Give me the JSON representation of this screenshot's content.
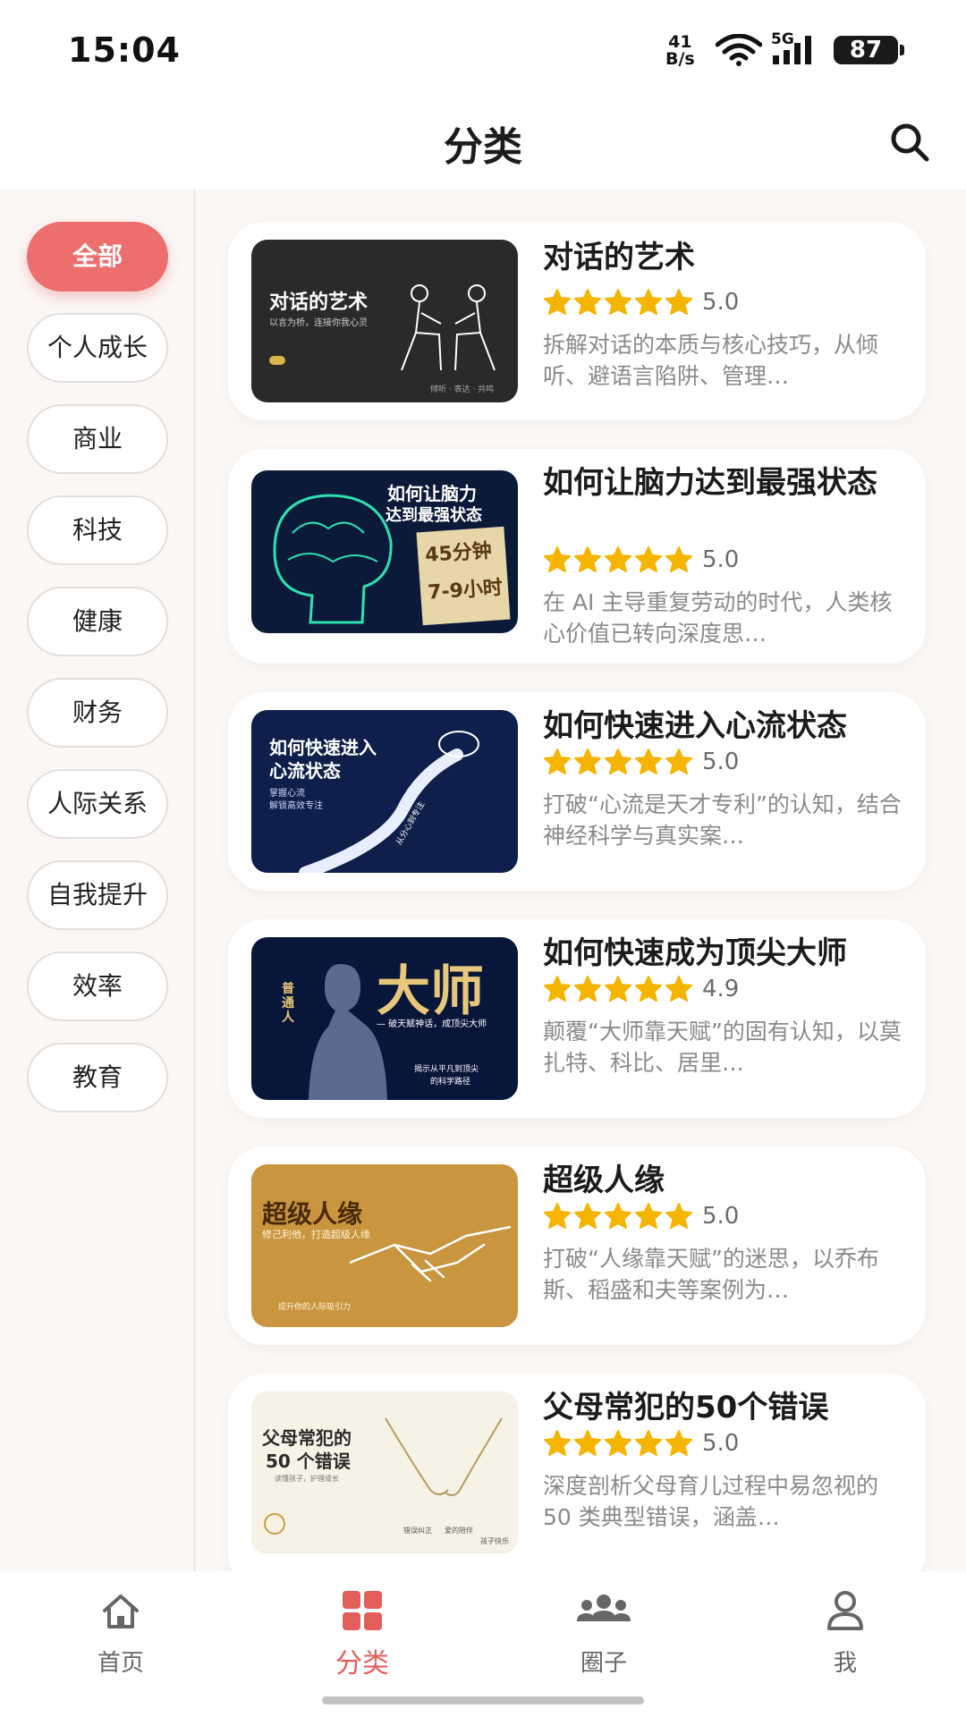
{
  "status_bar": {
    "time": "15:04",
    "speed_value": "41",
    "speed_unit": "B/s",
    "network": "5G",
    "battery": "87"
  },
  "header": {
    "title": "分类",
    "search_icon": "search-icon"
  },
  "sidebar": {
    "categories": [
      {
        "label": "全部",
        "active": true
      },
      {
        "label": "个人成长",
        "active": false
      },
      {
        "label": "商业",
        "active": false
      },
      {
        "label": "科技",
        "active": false
      },
      {
        "label": "健康",
        "active": false
      },
      {
        "label": "财务",
        "active": false
      },
      {
        "label": "人际关系",
        "active": false
      },
      {
        "label": "自我提升",
        "active": false
      },
      {
        "label": "效率",
        "active": false
      },
      {
        "label": "教育",
        "active": false
      }
    ]
  },
  "books": [
    {
      "title": "对话的艺术",
      "rating": 5.0,
      "rating_text": "5.0",
      "description": "拆解对话的本质与核心技巧，从倾听、避语言陷阱、管理…",
      "cover": {
        "line1": "对话的艺术",
        "line2": "以言为桥，连接你我心灵",
        "footer": "倾听 · 表达 · 共鸣"
      }
    },
    {
      "title": "如何让脑力达到最强状态",
      "rating": 5.0,
      "rating_text": "5.0",
      "description": "在 AI 主导重复劳动的时代，人类核心价值已转向深度思…",
      "cover": {
        "line1": "如何让脑力",
        "line2": "达到最强状态",
        "note1": "45分钟",
        "note2": "7-9小时"
      }
    },
    {
      "title": "如何快速进入心流状态",
      "rating": 5.0,
      "rating_text": "5.0",
      "description": "打破“心流是天才专利”的认知，结合神经科学与真实案…",
      "cover": {
        "line1": "如何快速进入",
        "line2": "心流状态",
        "line3": "掌握心流",
        "line4": "解锁高效专注",
        "path_text": "从分心到专注"
      }
    },
    {
      "title": "如何快速成为顶尖大师",
      "rating": 4.9,
      "rating_text": "4.9",
      "description": "颠覆“大师靠天赋”的固有认知，以莫扎特、科比、居里…",
      "cover": {
        "big": "大师",
        "side": "普通人",
        "sub": "— 破天赋神话，成顶尖大师",
        "foot1": "揭示从平凡到顶尖",
        "foot2": "的科学路径"
      }
    },
    {
      "title": "超级人缘",
      "rating": 5.0,
      "rating_text": "5.0",
      "description": "打破“人缘靠天赋”的迷思，以乔布斯、稻盛和夫等案例为…",
      "cover": {
        "line1": "超级人缘",
        "line2": "修己利他，打造超级人缘",
        "footer": "提升你的人际吸引力"
      }
    },
    {
      "title": "父母常犯的50个错误",
      "rating": 5.0,
      "rating_text": "5.0",
      "description": "深度剖析父母育儿过程中易忽视的 50 类典型错误，涵盖…",
      "cover": {
        "line1": "父母常犯的",
        "line2": "50 个错误",
        "line3": "读懂孩子，护理成长",
        "foot1": "错误纠正",
        "foot2": "爱的陪伴",
        "foot3": "孩子快乐"
      }
    }
  ],
  "bottom_nav": [
    {
      "label": "首页",
      "icon": "home-icon",
      "active": false
    },
    {
      "label": "分类",
      "icon": "category-icon",
      "active": true
    },
    {
      "label": "圈子",
      "icon": "group-icon",
      "active": false
    },
    {
      "label": "我",
      "icon": "profile-icon",
      "active": false
    }
  ],
  "colors": {
    "accent": "#ec6f6d",
    "star": "#f5b400",
    "sidebar_bg": "#faf7f5"
  }
}
